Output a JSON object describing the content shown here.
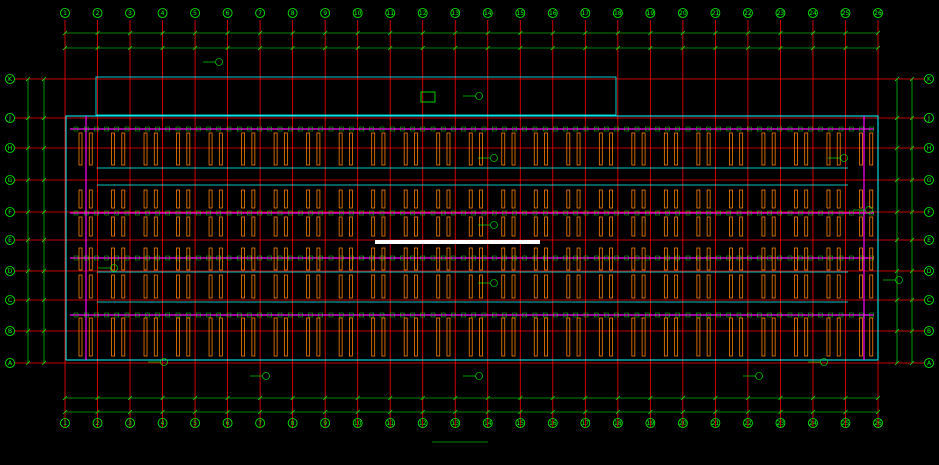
{
  "drawing": {
    "colors": {
      "background": "#000000",
      "grid_line": "#ff0000",
      "axis_bubble": "#00ff00",
      "dimension": "#00ff00",
      "outline": "#00ffff",
      "purlin": "#ff00ff",
      "pile": "#ff8000",
      "highlight": "#ffffff"
    },
    "column_axes": [
      "1",
      "2",
      "3",
      "4",
      "5",
      "6",
      "7",
      "8",
      "9",
      "10",
      "11",
      "12",
      "13",
      "14",
      "15",
      "16",
      "17",
      "18",
      "19",
      "20",
      "21",
      "22",
      "23",
      "24",
      "25",
      "26"
    ],
    "row_axes_left": [
      "K",
      "J",
      "H",
      "G",
      "F",
      "E",
      "D",
      "C",
      "B",
      "A"
    ],
    "row_axes_right": [
      "K",
      "J",
      "H",
      "G",
      "F",
      "E",
      "D",
      "C",
      "B",
      "A"
    ]
  }
}
